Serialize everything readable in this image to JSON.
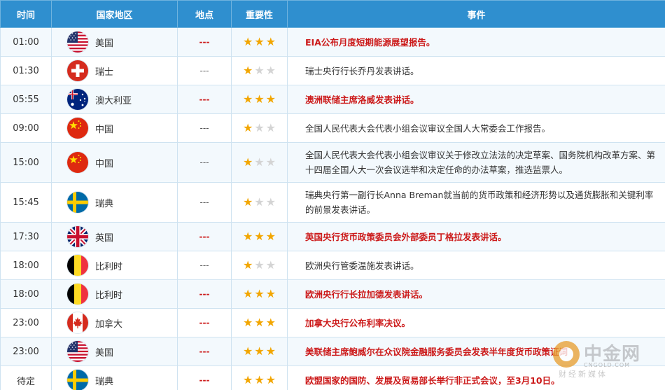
{
  "headers": {
    "time": "时间",
    "country": "国家地区",
    "place": "地点",
    "importance": "重要性",
    "event": "事件"
  },
  "rows": [
    {
      "time": "01:00",
      "flag": "us",
      "country": "美国",
      "place": "---",
      "stars": 3,
      "highlight": true,
      "event": "EIA公布月度短期能源展望报告。"
    },
    {
      "time": "01:30",
      "flag": "ch",
      "country": "瑞士",
      "place": "---",
      "stars": 1,
      "highlight": false,
      "event": "瑞士央行行长乔丹发表讲话。"
    },
    {
      "time": "05:55",
      "flag": "au",
      "country": "澳大利亚",
      "place": "---",
      "stars": 3,
      "highlight": true,
      "event": "澳洲联储主席洛威发表讲话。"
    },
    {
      "time": "09:00",
      "flag": "cn",
      "country": "中国",
      "place": "---",
      "stars": 1,
      "highlight": false,
      "event": "全国人民代表大会代表小组会议审议全国人大常委会工作报告。"
    },
    {
      "time": "15:00",
      "flag": "cn",
      "country": "中国",
      "place": "---",
      "stars": 1,
      "highlight": false,
      "event": "全国人民代表大会代表小组会议审议关于修改立法法的决定草案、国务院机构改革方案、第十四届全国人大一次会议选举和决定任命的办法草案，推选监票人。"
    },
    {
      "time": "15:45",
      "flag": "se",
      "country": "瑞典",
      "place": "---",
      "stars": 1,
      "highlight": false,
      "event": "瑞典央行第一副行长Anna Breman就当前的货币政策和经济形势以及通货膨胀和关键利率的前景发表讲话。"
    },
    {
      "time": "17:30",
      "flag": "gb",
      "country": "英国",
      "place": "---",
      "stars": 3,
      "highlight": true,
      "event": "英国央行货币政策委员会外部委员丁格拉发表讲话。"
    },
    {
      "time": "18:00",
      "flag": "be",
      "country": "比利时",
      "place": "---",
      "stars": 1,
      "highlight": false,
      "event": "欧洲央行管委温施发表讲话。"
    },
    {
      "time": "18:00",
      "flag": "be",
      "country": "比利时",
      "place": "---",
      "stars": 3,
      "highlight": true,
      "event": "欧洲央行行长拉加德发表讲话。"
    },
    {
      "time": "23:00",
      "flag": "ca",
      "country": "加拿大",
      "place": "---",
      "stars": 3,
      "highlight": true,
      "event": "加拿大央行公布利率决议。"
    },
    {
      "time": "23:00",
      "flag": "us",
      "country": "美国",
      "place": "---",
      "stars": 3,
      "highlight": true,
      "event": "美联储主席鲍威尔在众议院金融服务委员会发表半年度货币政策证词"
    },
    {
      "time": "待定",
      "flag": "se",
      "country": "瑞典",
      "place": "---",
      "stars": 3,
      "highlight": true,
      "event": "欧盟国家的国防、发展及贸易部长举行非正式会议，至3月10日。"
    }
  ],
  "watermark": {
    "title": "中金网",
    "url": "CNGOLD.COM",
    "subtitle": "财经新媒体"
  }
}
